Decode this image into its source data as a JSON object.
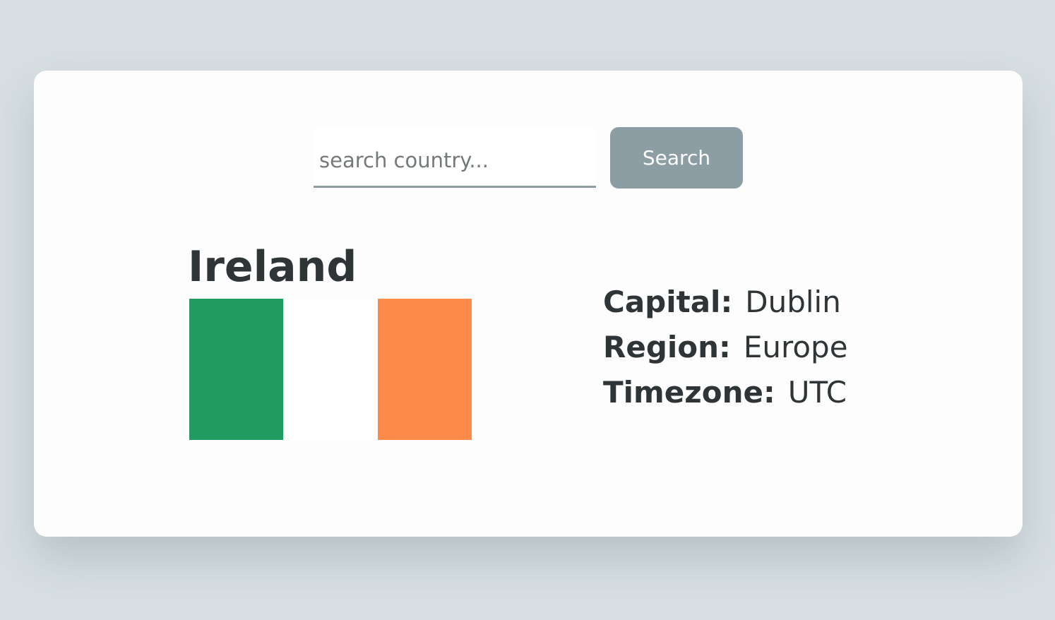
{
  "search": {
    "placeholder": "search country...",
    "value": "",
    "button_label": "Search"
  },
  "country": {
    "name": "Ireland",
    "flag_colors": [
      "#229b62",
      "#ffffff",
      "#fe8a4a"
    ],
    "details": [
      {
        "label": "Capital:",
        "value": "Dublin"
      },
      {
        "label": "Region:",
        "value": "Europe"
      },
      {
        "label": "Timezone:",
        "value": "UTC"
      }
    ]
  },
  "colors": {
    "background": "#d7dfe2",
    "card": "#fdfdfd",
    "accent": "#8c9ea3",
    "text": "#2f3537"
  }
}
